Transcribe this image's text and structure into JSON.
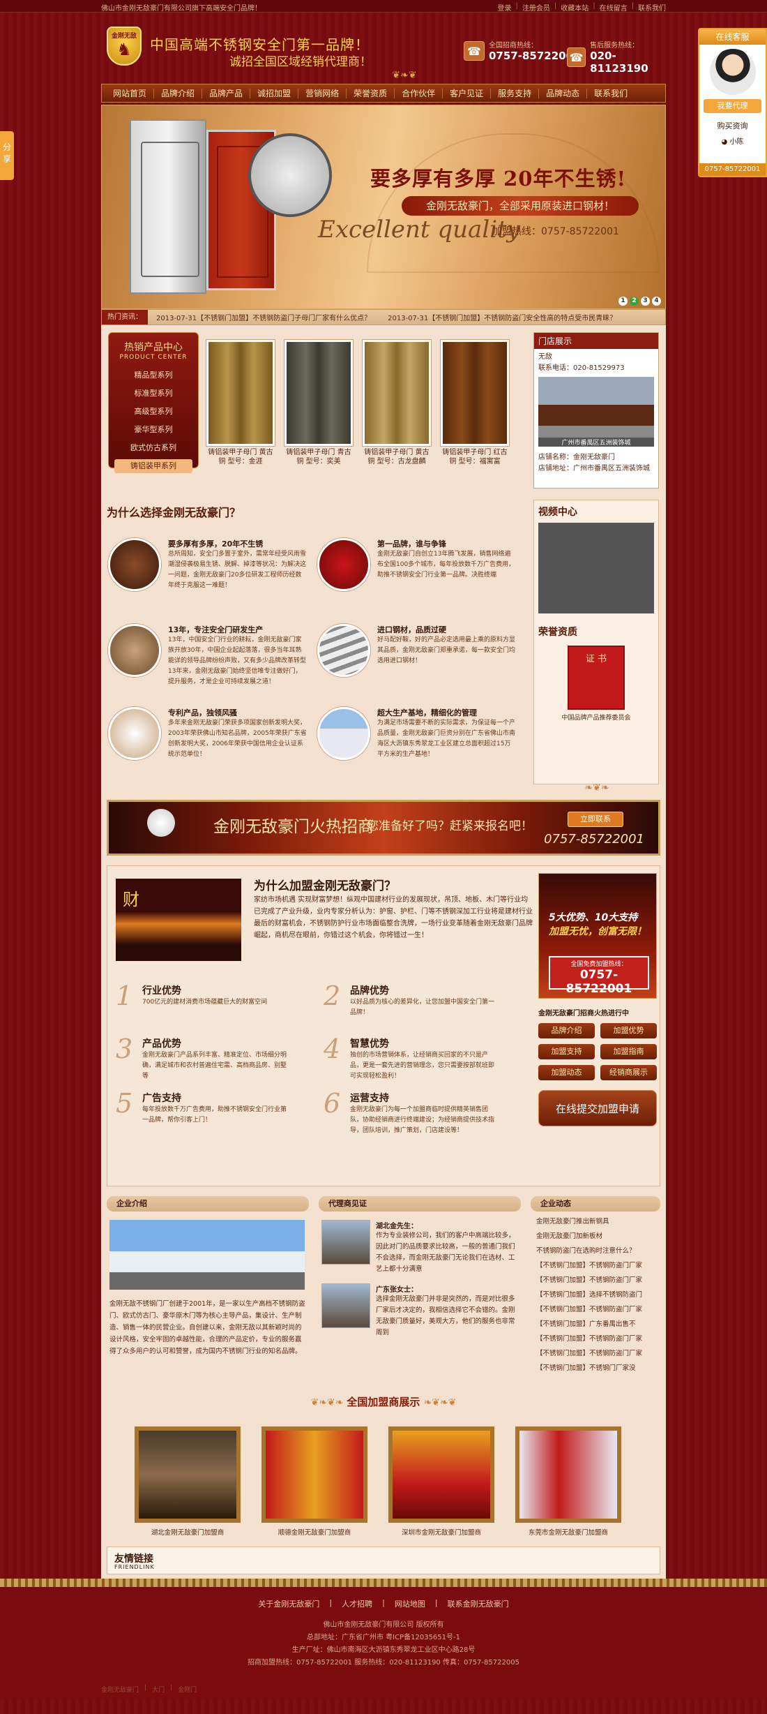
{
  "topbar": {
    "welcome": "佛山市金刚无敌豪门有限公司旗下高端安全门品牌！",
    "links": [
      "登录",
      "注册会员",
      "收藏本站",
      "在线留言",
      "联系我们"
    ]
  },
  "header": {
    "logo_text": "金刚无敌",
    "slogan1": "中国高端不锈钢安全门第一品牌！",
    "slogan2": "诚招全国区域经销代理商！",
    "hotline1_label": "全国招商热线：",
    "hotline1": "0757-85722001",
    "hotline2_label": "售后服务热线：",
    "hotline2": "020-81123190"
  },
  "nav": [
    "网站首页",
    "品牌介绍",
    "品牌产品",
    "诚招加盟",
    "营销网络",
    "荣誉资质",
    "合作伙伴",
    "客户见证",
    "服务支持",
    "品牌动态",
    "联系我们"
  ],
  "banner": {
    "title": "要多厚有多厚 20年不生锈!",
    "subtitle": "金刚无敌豪门，全部采用原装进口钢材！",
    "script": "Excellent quality",
    "hotline": "加盟热线：0757-85722001",
    "dots": [
      "1",
      "2",
      "3",
      "4"
    ],
    "active_dot": 1
  },
  "news": {
    "label": "热门资讯：",
    "items": [
      "2013-07-31【不锈钢门加盟】不锈钢防盗门子母门厂家有什么优点？",
      "2013-07-31【不锈钢门加盟】不锈钢防盗门安全性高的特点受市民青睐？"
    ]
  },
  "product_center": {
    "title": "热销产品中心",
    "title_en": "PRODUCT CENTER",
    "items": [
      "精品型系列",
      "标准型系列",
      "高级型系列",
      "豪华型系列",
      "欧式仿古系列",
      "铸铝装甲系列"
    ],
    "active": 5
  },
  "products": [
    {
      "caption": "铸铝装甲子母门 黄古铜 型号：金涯",
      "color1": "#b8944a",
      "color2": "#7a5a20"
    },
    {
      "caption": "铸铝装甲子母门 青古铜 型号：奕美",
      "color1": "#6a6a5a",
      "color2": "#3a3a30"
    },
    {
      "caption": "铸铝装甲子母门 黄古铜 型号：古龙盘麟",
      "color1": "#c4a468",
      "color2": "#8a6a2a"
    },
    {
      "caption": "铸铝装甲子母门 红古铜 型号：福寓富",
      "color1": "#8a4a1a",
      "color2": "#5a2a0a"
    }
  ],
  "store": {
    "title": "门店展示",
    "name": "无敌",
    "phone": "联系电话：020-81529973",
    "pic_caption": "广州市番禺区五洲装饰城",
    "store_name": "店铺名称：金刚无敌豪门",
    "address": "店铺地址：广州市番禺区五洲装饰城"
  },
  "why": {
    "title": "为什么选择金刚无敌豪门？",
    "items": [
      {
        "title": "要多厚有多厚，20年不生锈",
        "text": "总所周知，安全门多置于室外，需常年经受风雨雪潮湿侵袭极易生锈、脱解、掉漆等状况：为解决这一问题，金刚无敌豪门20多位研发工程师历经数年终于克服这一难题！",
        "bg": "radial-gradient(circle,#8a4a2a,#3a1a0a)"
      },
      {
        "title": "第一品牌，谁与争锋",
        "text": "金刚无敌豪门自创立13年腾飞发展，销售网络遍布全国100多个城市，每年投放数千万广告费用，助推不锈钢安全门行业第一品牌。决胜终端",
        "bg": "radial-gradient(circle,#c9141a,#6a0a08)"
      },
      {
        "title": "13年，专注安全门研发生产",
        "text": "13年，中国安全门行业的耕耘，金刚无敌豪门家族开放30年，中国企业起起落落，很多当年耳熟能详的领导品牌纷纷声败，又有多少品牌改革转型13年来，金刚无敌豪门始终坚信唯专注做好门，提升服务，才是企业可持续发展之道！",
        "bg": "radial-gradient(circle,#c9a27a,#6a4a2a)"
      },
      {
        "title": "进口钢材，品质过硬",
        "text": "好马配好鞍，好的产品必定选用最上乘的原料方显其品质，金刚无敌豪门郑重承诺，每一款安全门均选用进口钢材！",
        "bg": "repeating-linear-gradient(160deg,#eee 0 8px,#8a8a8a 8px 14px)"
      },
      {
        "title": "专利产品，独领风骚",
        "text": "多年来金刚无敌豪门荣获多项国家创新发明大奖，2003年荣获佛山市知名品牌，2005年荣获广东省创新发明大奖，2006年荣获中国信用企业认证系统示范单位！",
        "bg": "radial-gradient(circle,#fff,#c9a27a)"
      },
      {
        "title": "超大生产基地，精细化的管理",
        "text": "为满足市场需要不断的实际需求，为保证每一个产品质量，金刚无敌豪门巨资分别在广东省佛山市南海区大沥镇东秀翠龙工业区建立总面积超过15万平方米的生产基地！",
        "bg": "linear-gradient(#9ac0e8 0 40%,#e8e8f0 40%)"
      }
    ]
  },
  "side": {
    "video_title": "视频中心",
    "honor_title": "荣誉资质",
    "cert_text": "证 书",
    "cert_caption": "中国品牌产品推荐委员会"
  },
  "recruit": {
    "title": "金刚无敌豪门火热招商",
    "question": "您准备好了吗？赶紧来报名吧！",
    "button": "立即联系",
    "phone": "0757-85722001"
  },
  "join": {
    "title": "为什么加盟金刚无敌豪门？",
    "img_text": "财",
    "intro": "家纺市场机遇 实现财富梦想！纵观中国建材行业的发展现状，吊顶、地板、木门等行业均已完成了产业升级，业内专家分析认为：护窗、护栏、门等不锈钢深加工行业将是建材行业最后的财富机会，不锈钢防护行业市场面临整合洗牌，一场行业变革随着金刚无敌豪门品牌崛起，商机尽在眼前，你错过这个机会，你将错过一生！",
    "advantages": [
      {
        "num": "1",
        "title": "行业优势",
        "text": "700亿元的建材消费市场蕴藏巨大的财富空间"
      },
      {
        "num": "2",
        "title": "品牌优势",
        "text": "以好品质为核心的差异化，让您加盟中国安全门第一品牌！"
      },
      {
        "num": "3",
        "title": "产品优势",
        "text": "金刚无敌豪门产品系列丰富、精准定位、市场细分明确，满足城市和农村普遍住宅需、高档商品房、别墅等"
      },
      {
        "num": "4",
        "title": "智慧优势",
        "text": "独创的市场营销体系，让经销商买回家的不只是产品，更是一套先进的营销理念，您只需要按部就班即可实现轻松盈利！"
      },
      {
        "num": "5",
        "title": "广告支持",
        "text": "每年投放数千万广告费用，助推不锈钢安全门行业第一品牌，帮你引客上门！"
      },
      {
        "num": "6",
        "title": "运营支持",
        "text": "金刚无敌豪门为每一个加盟商临时提供精英销售团队，协助经销商进行终端建设；为经销商提供技术指导，团队培训，推广策划，门店建设等！"
      }
    ],
    "side_ad": {
      "line1": "5大优势、10大支持",
      "line2": "加盟无忧，创富无限！",
      "hot_label": "全国免费加盟热线：",
      "hot_phone": "0757-85722001"
    },
    "side_title": "金刚无敌豪门招商火热进行中",
    "side_buttons": [
      "品牌介绍",
      "加盟优势",
      "加盟支持",
      "加盟指南",
      "加盟动态",
      "经销商展示"
    ],
    "apply": "在线提交加盟申请"
  },
  "about": {
    "title": "企业介绍",
    "text": "金刚无敌不锈钢门厂创建于2001年，是一家以生产高档不锈钢防盗门、欧式仿古门、豪华原木门等为核心主导产品，集设计、生产制造、销售一体的民营企业。自创建以来，金刚无敌以其新颖时尚的设计风格，安全牢固的卓越性能，合理的产品定价，专业的服务赢得了众多用户的认可和赞誉，成为国内不锈钢门行业的知名品牌。"
  },
  "agents": {
    "title": "代理商见证",
    "items": [
      {
        "name": "湖北金先生：",
        "text": "作为专业装修公司，我们的客户中高端比较多，因此对门的品质要求比较高，一般的普通门我们不会选择，而金刚无敌豪门无论我们在选材、工艺上都十分满意"
      },
      {
        "name": "广东张女士：",
        "text": "选择金刚无敌豪门并非是突然的，而是对比很多厂家后才决定的，我相信选择它不会错的。金刚无敌豪门质量好，美观大方，他们的服务也非常周到"
      }
    ]
  },
  "dynamics": {
    "title": "企业动态",
    "items": [
      "金刚无敌豪门推出新钢具",
      "金刚无敌豪门加新板材",
      "不锈钢防盗门在选购时注意什么？",
      "【不锈钢门加盟】不锈钢防盗门厂家",
      "【不锈钢门加盟】不锈钢防盗门厂家",
      "【不锈钢门加盟】选择不锈钢防盗门",
      "【不锈钢门加盟】不锈钢防盗门厂家",
      "【不锈钢门加盟】广东番禺出售不",
      "【不锈钢门加盟】不锈钢防盗门厂家",
      "【不锈钢门加盟】不锈钢防盗门厂家",
      "【不锈钢门加盟】不锈钢门厂家没"
    ]
  },
  "showcase": {
    "title": "全国加盟商展示",
    "items": [
      {
        "caption": "湖北金刚无敌豪门加盟商",
        "bg": "linear-gradient(#4a3a2a,#8a6a4a 50%,#2a1a0a)"
      },
      {
        "caption": "顺德金刚无敌豪门加盟商",
        "bg": "linear-gradient(90deg,#c21a1a,#e8a020 50%,#c21a1a)"
      },
      {
        "caption": "深圳市金刚无敌豪门加盟商",
        "bg": "linear-gradient(#e8a020,#c21a1a 60%,#6a0a08)"
      },
      {
        "caption": "东莞市金刚无敌豪门加盟商",
        "bg": "linear-gradient(90deg,#e8e8f0,#c21a1a 40%,#e8e8f0)"
      }
    ]
  },
  "friend": {
    "title": "友情链接",
    "title_en": "FRIENDLINK"
  },
  "footer": {
    "nav": [
      "关于金刚无敌豪门",
      "人才招聘",
      "网站地图",
      "联系金刚无敌豪门"
    ],
    "lines": [
      "佛山市金刚无敌豪门有限公司 版权所有",
      "总部地址：广东省广州市 粤ICP备12035651号-1",
      "生产厂址：佛山市南海区大沥镇东秀翠龙工业区中心路28号",
      "招商加盟热线：0757-85722001 服务热线：020-81123190 传真：0757-85722005"
    ],
    "bottom": [
      "金刚无敌豪门",
      "大门",
      "金刚门"
    ]
  },
  "service": {
    "title": "在线客服",
    "agent_btn": "我要代理",
    "consult": "购买资询",
    "qq": "小陈",
    "tel": "0757-85722001"
  },
  "share": "分享"
}
